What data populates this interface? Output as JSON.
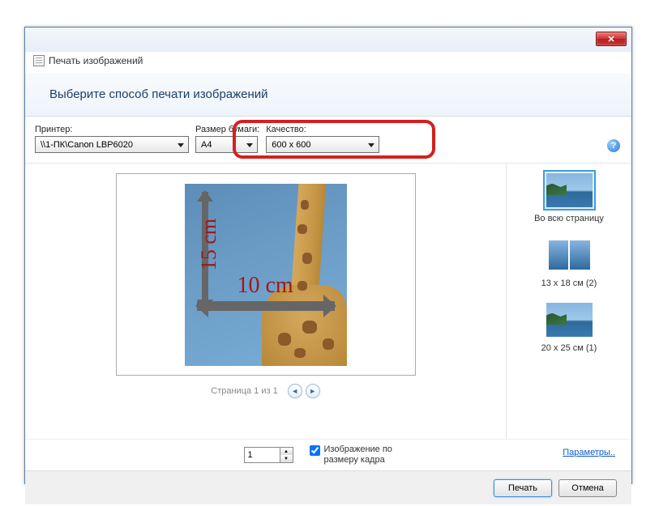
{
  "window": {
    "title": "Печать изображений"
  },
  "heading": "Выберите способ печати изображений",
  "options": {
    "printer_label": "Принтер:",
    "printer_value": "\\\\1-ПК\\Canon LBP6020",
    "paper_label": "Размер бумаги:",
    "paper_value": "A4",
    "quality_label": "Качество:",
    "quality_value": "600 x 600"
  },
  "preview": {
    "dim_v": "15 cm",
    "dim_h": "10 cm",
    "pager": "Страница 1 из 1"
  },
  "layouts": [
    {
      "label": "Во всю страницу",
      "selected": true
    },
    {
      "label": "13 x 18 см (2)",
      "selected": false
    },
    {
      "label": "20 x 25 см (1)",
      "selected": false
    }
  ],
  "bottom": {
    "copies_value": "1",
    "fit_label": "Изображение по размеру кадра",
    "fit_checked": true,
    "params_link": "Параметры.."
  },
  "footer": {
    "print": "Печать",
    "cancel": "Отмена"
  }
}
